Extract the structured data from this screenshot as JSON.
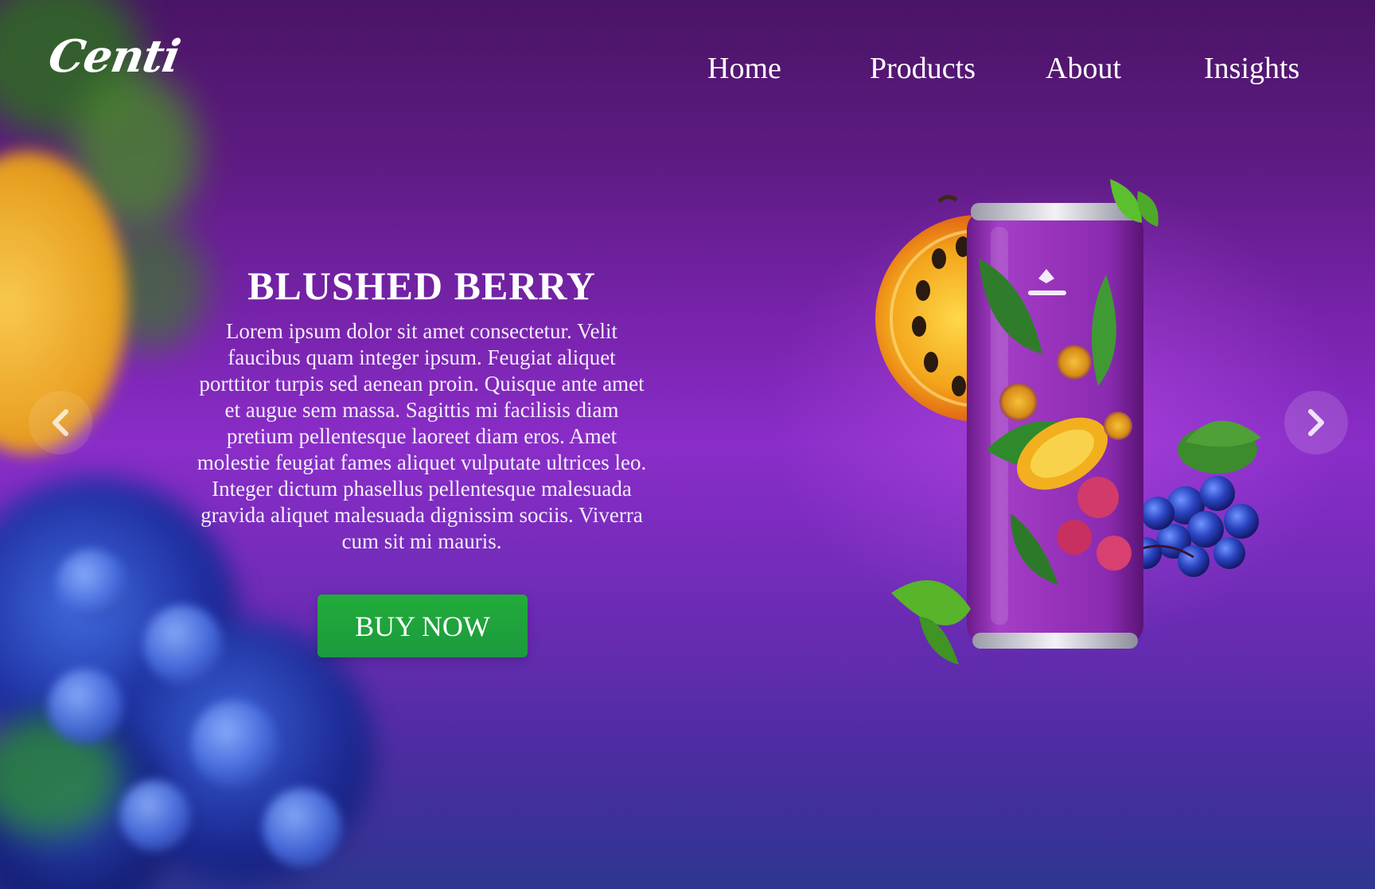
{
  "brand": {
    "logo_text": "Centi"
  },
  "nav": {
    "items": [
      {
        "label": "Home"
      },
      {
        "label": "Products"
      },
      {
        "label": "About"
      },
      {
        "label": "Insights"
      }
    ]
  },
  "hero": {
    "title": "BLUSHED BERRY",
    "description": "Lorem ipsum dolor sit amet consectetur. Velit faucibus quam integer ipsum. Feugiat aliquet porttitor turpis sed aenean proin. Quisque ante amet et augue sem massa. Sagittis mi facilisis diam pretium pellentesque laoreet diam eros. Amet molestie feugiat fames aliquet vulputate ultrices leo. Integer dictum phasellus pellentesque malesuada gravida aliquet malesuada dignissim sociis. Viverra cum sit mi mauris.",
    "cta_label": "BUY NOW"
  },
  "carousel": {
    "prev_icon": "chevron-left-icon",
    "next_icon": "chevron-right-icon"
  },
  "colors": {
    "background_top": "#4a1466",
    "background_mid": "#8a2dc8",
    "background_bottom": "#2e3690",
    "cta_green": "#1c9a3e",
    "text": "#ffffff"
  }
}
